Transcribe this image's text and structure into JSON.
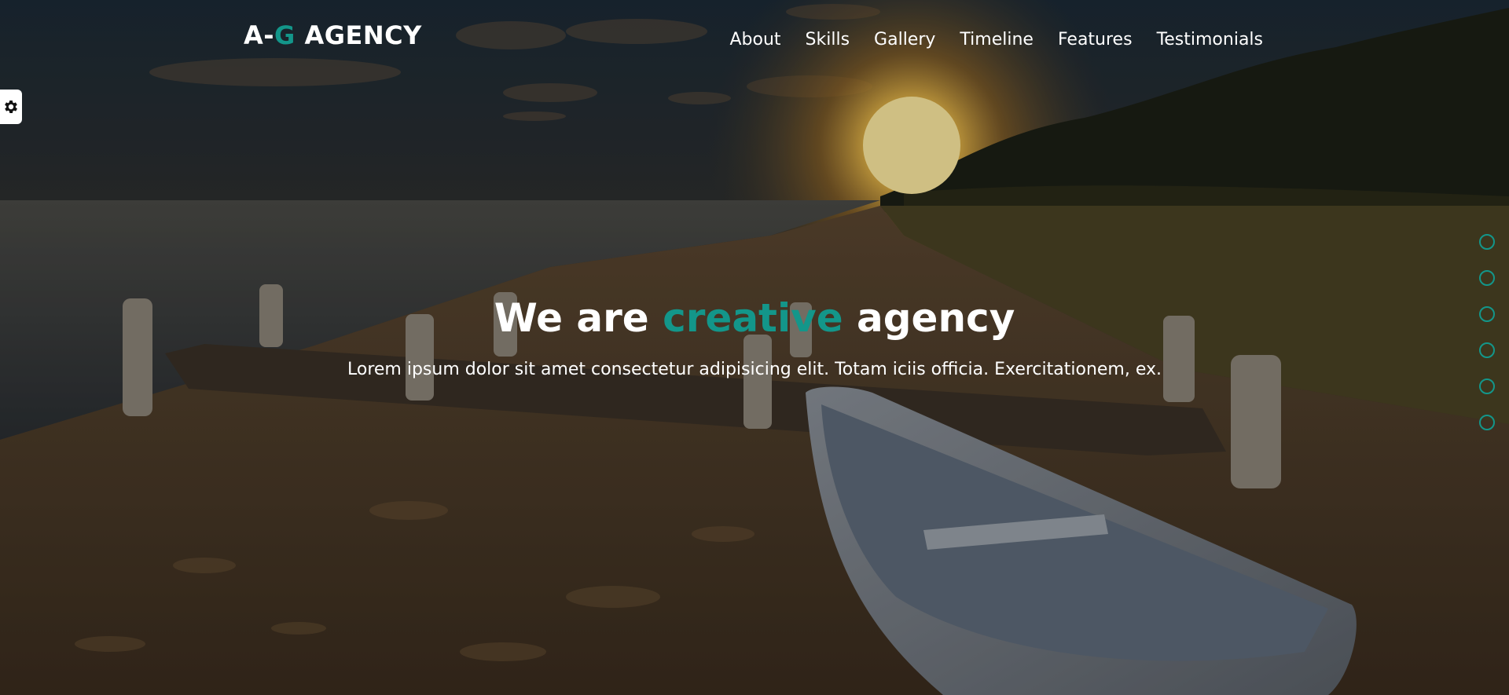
{
  "brand": {
    "prefix": "A-",
    "accent": "G",
    "suffix": " AGENCY",
    "accent_color": "#13968a"
  },
  "nav": {
    "items": [
      {
        "label": "About"
      },
      {
        "label": "Skills"
      },
      {
        "label": "Gallery"
      },
      {
        "label": "Timeline"
      },
      {
        "label": "Features"
      },
      {
        "label": "Testimonials"
      }
    ]
  },
  "hero": {
    "title_before": "We are ",
    "title_accent": "creative",
    "title_after": " agency",
    "subtitle": "Lorem ipsum dolor sit amet consectetur adipisicing elit. Totam iciis officia. Exercitationem, ex.",
    "background": "sunset-beach-rowboat-image"
  },
  "settings": {
    "icon": "gear-icon"
  },
  "bullets": {
    "count": 6,
    "color": "#13968a"
  }
}
